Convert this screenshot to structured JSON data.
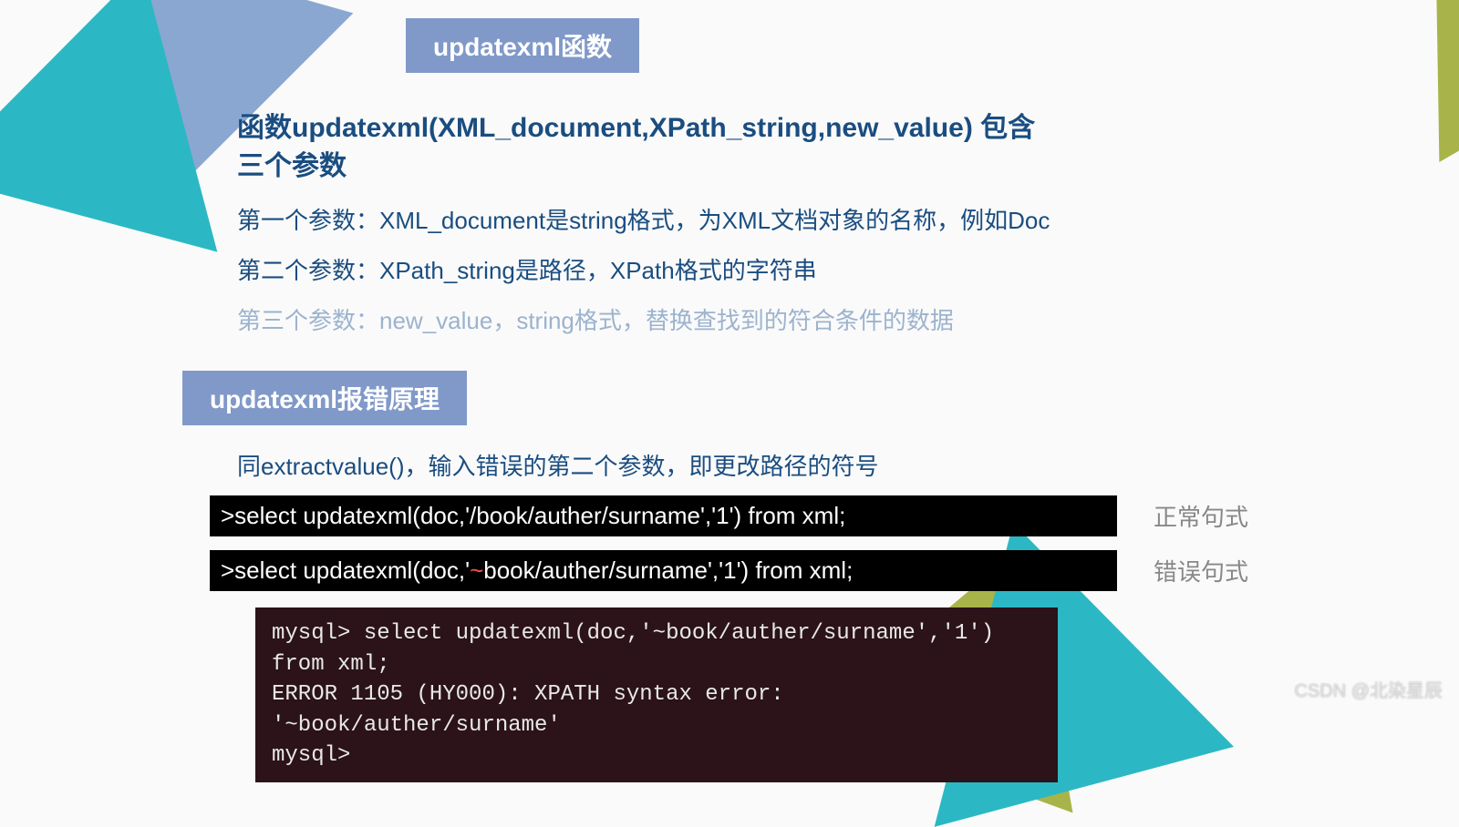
{
  "title1": "updatexml函数",
  "heading1_line1": "函数updatexml(XML_document,XPath_string,new_value)  包含",
  "heading1_line2": "三个参数",
  "param1": "第一个参数：XML_document是string格式，为XML文档对象的名称，例如Doc",
  "param2": "第二个参数：XPath_string是路径，XPath格式的字符串",
  "param3": "第三个参数：new_value，string格式，替换查找到的符合条件的数据",
  "title2": "updatexml报错原理",
  "desc2": "同extractvalue()，输入错误的第二个参数，即更改路径的符号",
  "code_normal_prefix": ">select updatexml(doc,'/book/auther/surname','1') from xml;",
  "label_normal": "正常句式",
  "code_error_prefix": ">select updatexml(doc,'",
  "code_error_tilde": "~",
  "code_error_suffix": "book/auther/surname','1') from xml;",
  "label_error": "错误句式",
  "terminal_line1": "mysql> select updatexml(doc,'~book/auther/surname','1') from xml;",
  "terminal_line2": "ERROR 1105 (HY000): XPATH syntax error: '~book/auther/surname'",
  "terminal_line3": "mysql>",
  "watermark": "CSDN @北染星辰"
}
